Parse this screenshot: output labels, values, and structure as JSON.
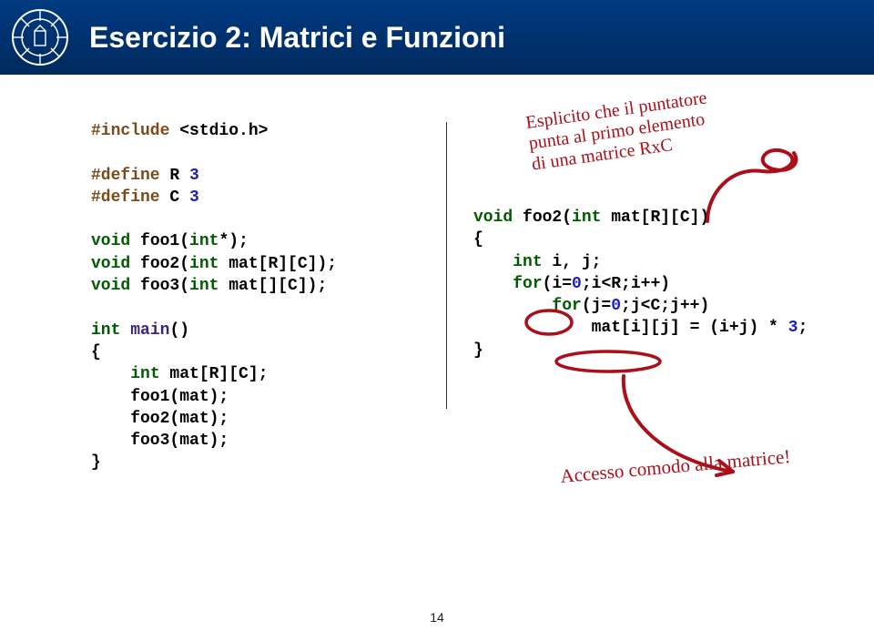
{
  "header": {
    "title": "Esercizio 2: Matrici e Funzioni"
  },
  "left": {
    "l1a": "#include",
    "l1b": " <stdio.h>",
    "l2a": "#define",
    "l2b": " R ",
    "l2c": "3",
    "l3a": "#define",
    "l3b": " C ",
    "l3c": "3",
    "l4a": "void",
    "l4b": " foo1(",
    "l4c": "int",
    "l4d": "*);",
    "l5a": "void",
    "l5b": " foo2(",
    "l5c": "int",
    "l5d": " mat[R][C]);",
    "l6a": "void",
    "l6b": " foo3(",
    "l6c": "int",
    "l6d": " mat[][C]);",
    "l7a": "int",
    "l7b": " ",
    "l7c": "main",
    "l7d": "()",
    "l8": "{",
    "l9a": "    ",
    "l9b": "int",
    "l9c": " mat[R][C];",
    "l10": "    foo1(mat);",
    "l11": "    foo2(mat);",
    "l12": "    foo3(mat);",
    "l13": "}"
  },
  "right": {
    "hand_top_1": "Esplicito che il puntatore",
    "hand_top_2": "punta al primo elemento",
    "hand_top_3": "di una matrice RxC",
    "r1a": "void",
    "r1b": " foo2(",
    "r1c": "int",
    "r1d": " mat[R][C])",
    "r2": "{",
    "r3a": "    ",
    "r3b": "int",
    "r3c": " i, j;",
    "r4a": "    ",
    "r4b": "for",
    "r4c": "(i=",
    "r4d": "0",
    "r4e": ";i<R;i++)",
    "r5a": "        ",
    "r5b": "for",
    "r5c": "(j=",
    "r5d": "0",
    "r5e": ";j<C;j++)",
    "r6a": "            mat[i][j] = (i+j) * ",
    "r6b": "3",
    "r6c": ";",
    "r7": "}",
    "hand_bottom": "Accesso comodo alla matrice!"
  },
  "page": "14"
}
